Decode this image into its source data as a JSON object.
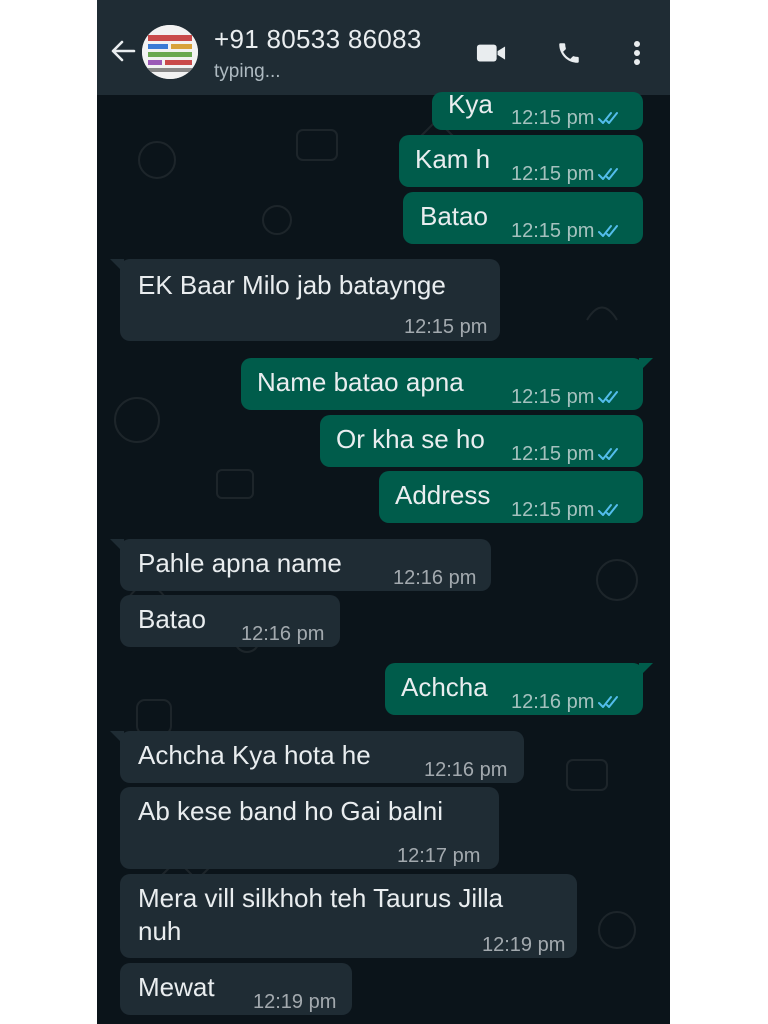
{
  "header": {
    "contact_name": "+91 80533 86083",
    "status": "typing..."
  },
  "messages": [
    {
      "dir": "out",
      "text": "Kya",
      "time": "12:15 pm",
      "read": true
    },
    {
      "dir": "out",
      "text": "Kam h",
      "time": "12:15 pm",
      "read": true
    },
    {
      "dir": "out",
      "text": "Batao",
      "time": "12:15 pm",
      "read": true
    },
    {
      "dir": "in",
      "text": "EK Baar Milo jab bataynge",
      "time": "12:15 pm"
    },
    {
      "dir": "out",
      "text": "Name batao apna",
      "time": "12:15 pm",
      "read": true
    },
    {
      "dir": "out",
      "text": "Or kha se ho",
      "time": "12:15 pm",
      "read": true
    },
    {
      "dir": "out",
      "text": "Address",
      "time": "12:15 pm",
      "read": true
    },
    {
      "dir": "in",
      "text": "Pahle apna name",
      "time": "12:16 pm"
    },
    {
      "dir": "in",
      "text": "Batao",
      "time": "12:16 pm"
    },
    {
      "dir": "out",
      "text": "Achcha",
      "time": "12:16 pm",
      "read": true
    },
    {
      "dir": "in",
      "text": "Achcha Kya hota he",
      "time": "12:16 pm"
    },
    {
      "dir": "in",
      "text": "Ab kese band ho Gai balni",
      "time": "12:17 pm"
    },
    {
      "dir": "in",
      "text": "Mera vill silkhoh teh Taurus Jilla",
      "text2": "nuh",
      "time": "12:19 pm"
    },
    {
      "dir": "in",
      "text": "Mewat",
      "time": "12:19 pm"
    }
  ],
  "colors": {
    "chat_background": "#0b141a",
    "header_background": "#1f2c34",
    "outgoing_bubble": "#005c4b",
    "incoming_bubble": "#1f2c34",
    "read_ticks": "#53bdeb"
  }
}
